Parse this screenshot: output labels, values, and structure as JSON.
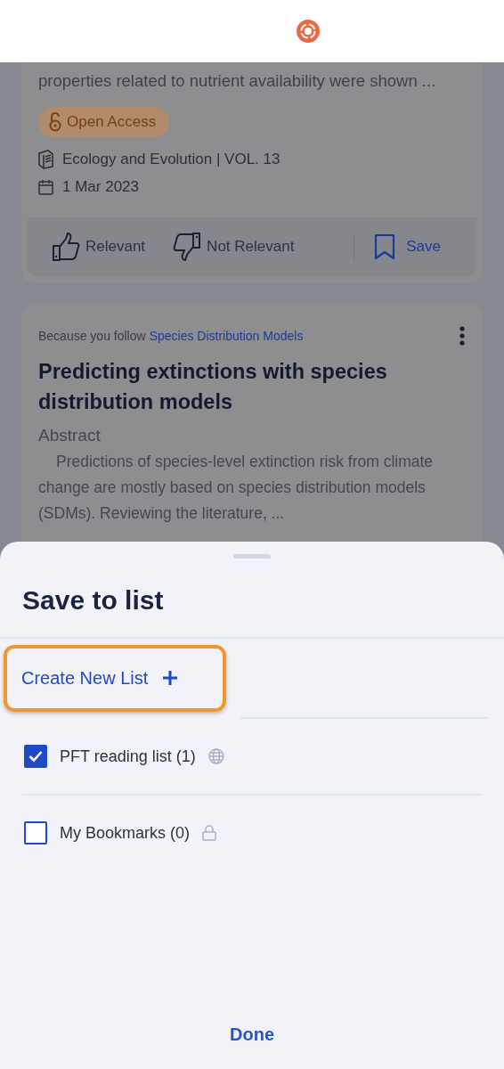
{
  "feed": {
    "cards": [
      {
        "kind": "partial",
        "snippet": "properties related to nutrient availability were shown ...",
        "badge": "Open Access",
        "journal": "Ecology and Evolution | VOL. 13",
        "date": "1 Mar 2023",
        "actions": [
          {
            "kind": "like",
            "label": "Relevant"
          },
          {
            "kind": "dislike",
            "label": "Not Relevant"
          },
          {
            "kind": "save",
            "label": "Save"
          }
        ]
      },
      {
        "kind": "full",
        "follow_prefix": "Because you follow",
        "follow_topic": "Species Distribution Models",
        "title": "Predicting extinctions with species distribution models",
        "abstract_label": "Abstract",
        "abstract": "Predictions of species-level extinction risk from climate change are mostly based on species distribution models (SDMs). Reviewing the literature, ..."
      }
    ]
  },
  "sheet": {
    "title": "Save to list",
    "create_button": {
      "label": "Create New List",
      "highlighted": true
    },
    "lists": [
      {
        "name": "PFT reading list (1)",
        "checked": true,
        "kind": "public"
      },
      {
        "name": "My Bookmarks (0)",
        "checked": false,
        "kind": "private"
      }
    ],
    "done": "Done"
  }
}
